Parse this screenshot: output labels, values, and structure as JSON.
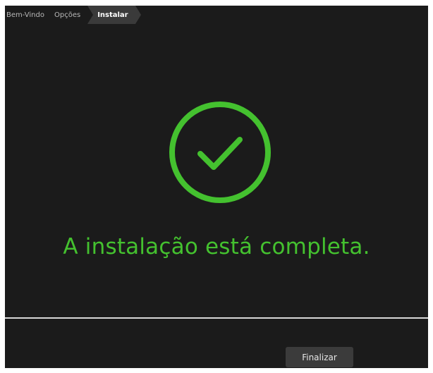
{
  "breadcrumb": {
    "steps": [
      {
        "label": "Bem-Vindo"
      },
      {
        "label": "Opções"
      },
      {
        "label": "Instalar"
      }
    ]
  },
  "status": {
    "icon": "check-circle-icon",
    "message": "A instalação está completa."
  },
  "footer": {
    "finish_label": "Finalizar"
  },
  "colors": {
    "accent": "#44c12f",
    "background": "#1b1b1b",
    "button": "#3b3b3b"
  }
}
